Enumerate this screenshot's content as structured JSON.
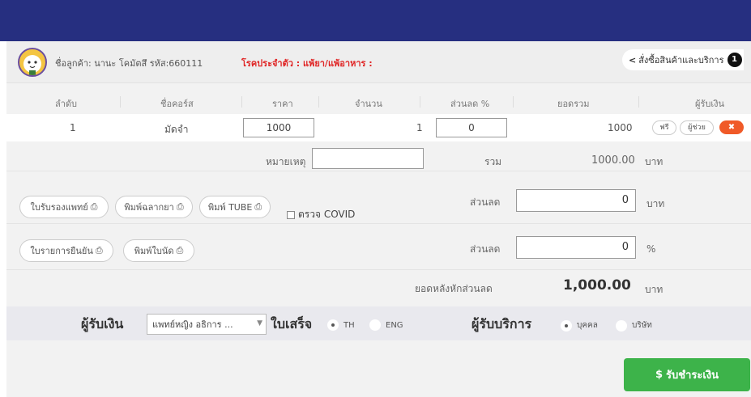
{
  "customer": {
    "name_label": "ชื่อลูกค้า: นานะ โคมัตสึ รหัส:660111",
    "allergy_label": "โรคประจำตัว : แพ้ยา/แพ้อาหาร :"
  },
  "header": {
    "back_label": "สั่งซื้อสินค้าและบริการ",
    "badge": "1"
  },
  "table": {
    "columns": [
      "ลำดับ",
      "ชื่อคอร์ส",
      "ราคา",
      "จำนวน",
      "ส่วนลด %",
      "ยอดรวม",
      "ผู้รับเงิน"
    ],
    "row": {
      "index": "1",
      "course": "มัดจำ",
      "price": "1000",
      "qty": "1",
      "discount": "0",
      "total": "1000",
      "pill1": "ฟรี",
      "pill2": "ผู้ช่วย",
      "delete": "✖"
    }
  },
  "note": {
    "label": "หมายเหตุ",
    "value": ""
  },
  "sum": {
    "label": "รวม",
    "value": "1000.00",
    "unit": "บาท"
  },
  "buttons": {
    "doctor_cert": "ใบรับรองแพทย์",
    "print_label": "พิมพ์ฉลากยา",
    "print_tube": "พิมพ์ TUBE",
    "confirm_list": "ใบรายการยืนยัน",
    "print_appointment": "พิมพ์ใบนัด",
    "print_icon": "⎙"
  },
  "covid": {
    "label": "ตรวจ COVID",
    "checked": false
  },
  "discount_baht": {
    "label": "ส่วนลด",
    "value": "0",
    "unit": "บาท"
  },
  "discount_pct": {
    "label": "ส่วนลด",
    "value": "0",
    "unit": "%"
  },
  "net": {
    "label": "ยอดหลังหักส่วนลด",
    "value": "1,000.00",
    "unit": "บาท"
  },
  "receiver": {
    "label": "ผู้รับเงิน",
    "selected": "แพทย์หญิง อธิการ ...",
    "caret": "▼"
  },
  "receipt": {
    "label": "ใบเสร็จ",
    "opt1": "TH",
    "opt2": "ENG",
    "selected": "TH"
  },
  "service": {
    "label": "ผู้รับบริการ",
    "opt1": "บุคคล",
    "opt2": "บริษัท",
    "selected": "บุคคล"
  },
  "pay": {
    "label": "รับชำระเงิน",
    "icon": "$"
  }
}
